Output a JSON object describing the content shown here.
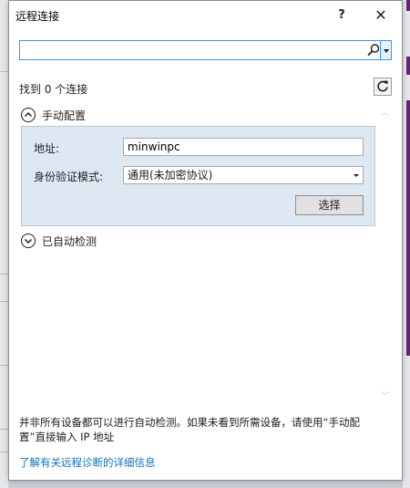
{
  "dialog": {
    "title": "远程连接",
    "help_label": "?",
    "close_label": "✕"
  },
  "search": {
    "value": "",
    "placeholder": ""
  },
  "results": {
    "found_text": "找到 0 个连接"
  },
  "manual": {
    "header": "手动配置",
    "address_label": "地址:",
    "address_value": "minwinpc",
    "auth_label": "身份验证模式:",
    "auth_value": "通用(未加密协议)",
    "select_button": "选择"
  },
  "auto_detect": {
    "header": "已自动检测"
  },
  "footer": {
    "note": "并非所有设备都可以进行自动检测。如果未看到所需设备，请使用“手动配置”直接输入 IP 地址",
    "link": "了解有关远程诊断的详细信息"
  },
  "icons": {
    "search": "search-icon",
    "dropdown": "chevron-down-icon",
    "refresh": "refresh-icon",
    "collapse": "chevron-up-icon",
    "expand": "chevron-down-icon"
  },
  "colors": {
    "focus_border": "#3399ff",
    "panel_bg": "#dde8f3",
    "link": "#0e70c0"
  }
}
